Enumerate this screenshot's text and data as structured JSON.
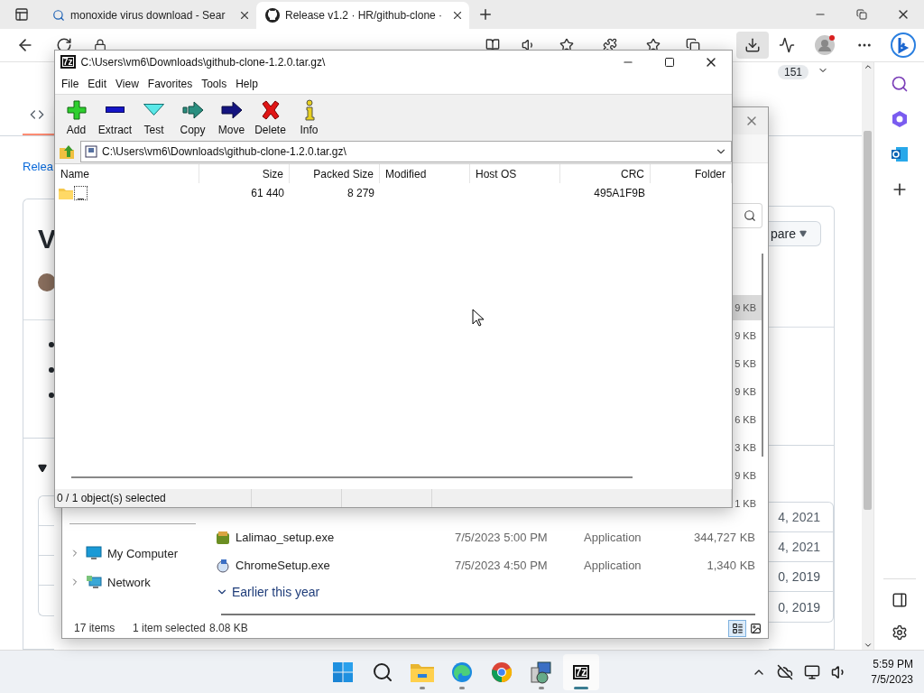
{
  "browser": {
    "tabs": [
      {
        "title": "monoxide virus download - Sear",
        "kind": "search",
        "selected": false
      },
      {
        "title": "Release v1.2 · HR/github-clone ·",
        "kind": "github",
        "selected": true
      }
    ],
    "page": {
      "star_count": "151",
      "breadcrumb": "Relea",
      "heading": "V",
      "compare_button": "pare",
      "assets": [
        {
          "date": "4, 2021",
          "kind": "package"
        },
        {
          "date": "4, 2021",
          "kind": "package"
        },
        {
          "date": "0, 2019",
          "kind": "archive"
        },
        {
          "date": "0, 2019",
          "kind": "archive"
        }
      ]
    }
  },
  "explorer": {
    "size_column": [
      {
        "size": "9 KB",
        "selected": true
      },
      {
        "size": "9 KB",
        "selected": false
      },
      {
        "size": "5 KB",
        "selected": false
      },
      {
        "size": "9 KB",
        "selected": false
      },
      {
        "size": "6 KB",
        "selected": false
      },
      {
        "size": "3 KB",
        "selected": false
      },
      {
        "size": "9 KB",
        "selected": false
      },
      {
        "size": "1 KB",
        "selected": false
      }
    ],
    "nav": [
      {
        "label": "My Computer",
        "kind": "computer",
        "expanded": false
      },
      {
        "label": "Network",
        "kind": "network",
        "expanded": false
      }
    ],
    "files": [
      {
        "name": "Lalimao_setup.exe",
        "kind": "installer",
        "modified": "7/5/2023 5:00 PM",
        "type": "Application",
        "size": "344,727 KB"
      },
      {
        "name": "ChromeSetup.exe",
        "kind": "setup",
        "modified": "7/5/2023 4:50 PM",
        "type": "Application",
        "size": "1,340 KB"
      }
    ],
    "group": {
      "label": "Earlier this year",
      "expanded": true
    },
    "status": {
      "count": "17 items",
      "selection": "1 item selected",
      "selection_size": "8.08 KB"
    },
    "views": [
      {
        "kind": "details",
        "selected": true
      },
      {
        "kind": "tiles",
        "selected": false
      }
    ]
  },
  "sevenzip": {
    "logo": "7z",
    "title": "C:\\Users\\vm6\\Downloads\\github-clone-1.2.0.tar.gz\\",
    "menu": [
      "File",
      "Edit",
      "View",
      "Favorites",
      "Tools",
      "Help"
    ],
    "toolbar": [
      {
        "kind": "add",
        "label": "Add"
      },
      {
        "kind": "extract",
        "label": "Extract"
      },
      {
        "kind": "test",
        "label": "Test"
      },
      {
        "kind": "copy",
        "label": "Copy"
      },
      {
        "kind": "move",
        "label": "Move"
      },
      {
        "kind": "delete",
        "label": "Delete"
      },
      {
        "kind": "info",
        "label": "Info"
      }
    ],
    "path": "C:\\Users\\vm6\\Downloads\\github-clone-1.2.0.tar.gz\\",
    "columns": [
      "Name",
      "Size",
      "Packed Size",
      "Modified",
      "Host OS",
      "CRC",
      "Folder"
    ],
    "rows": [
      {
        "name": "_",
        "size": "61 440",
        "packed_size": "8 279",
        "crc": "495A1F9B",
        "selected": false
      }
    ],
    "status": "0 / 1 object(s) selected"
  },
  "taskbar": {
    "apps": [
      {
        "kind": "start",
        "running": false,
        "selected": false
      },
      {
        "kind": "search",
        "running": false,
        "selected": false
      },
      {
        "kind": "files",
        "running": true,
        "selected": false
      },
      {
        "kind": "edge",
        "running": true,
        "selected": false
      },
      {
        "kind": "chrome",
        "running": false,
        "selected": false
      },
      {
        "kind": "setup",
        "running": true,
        "selected": false
      },
      {
        "kind": "sevenzip",
        "label": "7z",
        "running": true,
        "selected": true
      }
    ],
    "time": "5:59 PM",
    "date": "7/5/2023"
  }
}
